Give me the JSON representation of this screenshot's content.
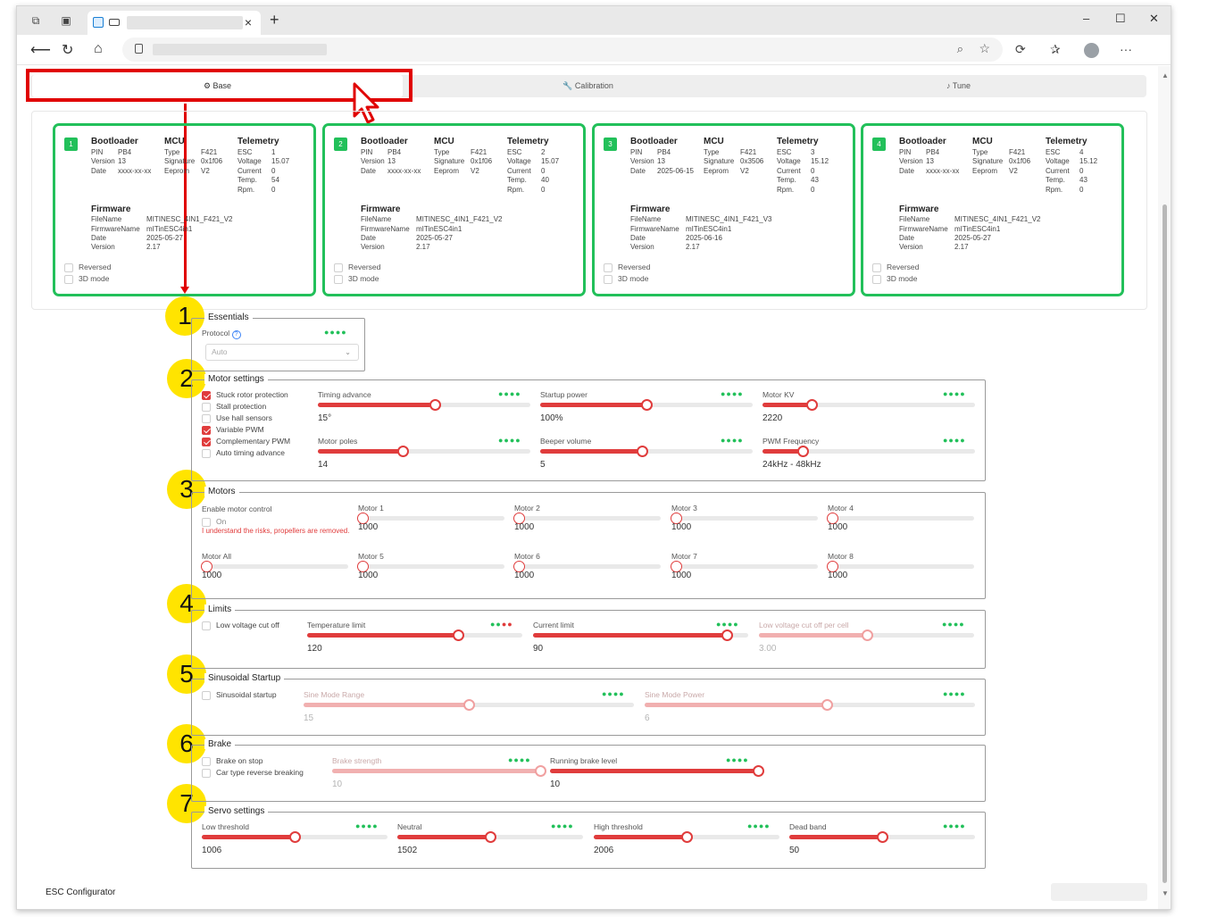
{
  "browser": {
    "tab_close": "×",
    "new_tab": "+",
    "more": "···",
    "controls": {
      "minimize": "–",
      "maximize": "☐",
      "close": "✕"
    }
  },
  "app": {
    "tabs": [
      {
        "label": "Base",
        "icon": "gear-icon",
        "active": true
      },
      {
        "label": "Calibration",
        "icon": "wrench-icon",
        "active": false
      },
      {
        "label": "Tune",
        "icon": "music-note-icon",
        "active": false
      }
    ],
    "footer": "ESC Configurator"
  },
  "escs": [
    {
      "id": "1",
      "bootloader": {
        "title": "Bootloader",
        "pin": "PB4",
        "version": "13",
        "date": "xxxx-xx-xx"
      },
      "mcu": {
        "title": "MCU",
        "type": "F421",
        "signature": "0x1f06",
        "eeprom": "V2"
      },
      "telemetry": {
        "title": "Telemetry",
        "esc": "1",
        "voltage": "15.07",
        "current": "0",
        "temp": "54",
        "rpm": "0"
      },
      "firmware": {
        "title": "Firmware",
        "filename": "MITINESC_4IN1_F421_V2",
        "firmwarename": "mITinESC4in1",
        "date": "2025-05-27",
        "version": "2.17"
      },
      "reversed": "Reversed",
      "mode3d": "3D mode"
    },
    {
      "id": "2",
      "bootloader": {
        "title": "Bootloader",
        "pin": "PB4",
        "version": "13",
        "date": "xxxx-xx-xx"
      },
      "mcu": {
        "title": "MCU",
        "type": "F421",
        "signature": "0x1f06",
        "eeprom": "V2"
      },
      "telemetry": {
        "title": "Telemetry",
        "esc": "2",
        "voltage": "15.07",
        "current": "0",
        "temp": "40",
        "rpm": "0"
      },
      "firmware": {
        "title": "Firmware",
        "filename": "MITINESC_4IN1_F421_V2",
        "firmwarename": "mITinESC4in1",
        "date": "2025-05-27",
        "version": "2.17"
      },
      "reversed": "Reversed",
      "mode3d": "3D mode"
    },
    {
      "id": "3",
      "bootloader": {
        "title": "Bootloader",
        "pin": "PB4",
        "version": "13",
        "date": "2025-06-15"
      },
      "mcu": {
        "title": "MCU",
        "type": "F421",
        "signature": "0x3506",
        "eeprom": "V2"
      },
      "telemetry": {
        "title": "Telemetry",
        "esc": "3",
        "voltage": "15.12",
        "current": "0",
        "temp": "43",
        "rpm": "0"
      },
      "firmware": {
        "title": "Firmware",
        "filename": "MITINESC_4IN1_F421_V3",
        "firmwarename": "mITinESC4in1",
        "date": "2025-06-16",
        "version": "2.17"
      },
      "reversed": "Reversed",
      "mode3d": "3D mode"
    },
    {
      "id": "4",
      "bootloader": {
        "title": "Bootloader",
        "pin": "PB4",
        "version": "13",
        "date": "xxxx-xx-xx"
      },
      "mcu": {
        "title": "MCU",
        "type": "F421",
        "signature": "0x1f06",
        "eeprom": "V2"
      },
      "telemetry": {
        "title": "Telemetry",
        "esc": "4",
        "voltage": "15.12",
        "current": "0",
        "temp": "43",
        "rpm": "0"
      },
      "firmware": {
        "title": "Firmware",
        "filename": "MITINESC_4IN1_F421_V2",
        "firmwarename": "mITinESC4in1",
        "date": "2025-05-27",
        "version": "2.17"
      },
      "reversed": "Reversed",
      "mode3d": "3D mode"
    }
  ],
  "labels": {
    "pin": "PIN",
    "version": "Version",
    "date": "Date",
    "type": "Type",
    "signature": "Signature",
    "eeprom": "Eeprom",
    "esc": "ESC",
    "voltage": "Voltage",
    "current": "Current",
    "temp": "Temp.",
    "rpm": "Rpm.",
    "filename": "FileName",
    "firmwarename": "FirmwareName"
  },
  "callouts": [
    "1",
    "2",
    "3",
    "4",
    "5",
    "6",
    "7"
  ],
  "essentials": {
    "legend": "Essentials",
    "protocol_label": "Protocol",
    "protocol_value": "Auto",
    "help": "?",
    "dots": "●●●●"
  },
  "motor_settings": {
    "legend": "Motor settings",
    "checkboxes": [
      {
        "label": "Stuck rotor protection",
        "checked": true
      },
      {
        "label": "Stall protection",
        "checked": false
      },
      {
        "label": "Use hall sensors",
        "checked": false
      },
      {
        "label": "Variable PWM",
        "checked": true
      },
      {
        "label": "Complementary PWM",
        "checked": true
      },
      {
        "label": "Auto timing advance",
        "checked": false
      }
    ],
    "sliders": [
      {
        "label": "Timing advance",
        "value": "15°",
        "level": 0.55
      },
      {
        "label": "Startup power",
        "value": "100%",
        "level": 0.5
      },
      {
        "label": "Motor KV",
        "value": "2220",
        "level": 0.23
      },
      {
        "label": "Motor poles",
        "value": "14",
        "level": 0.4
      },
      {
        "label": "Beeper volume",
        "value": "5",
        "level": 0.48
      },
      {
        "label": "PWM Frequency",
        "value": "24kHz - 48kHz",
        "level": 0.19
      }
    ]
  },
  "motors": {
    "legend": "Motors",
    "enable_label": "Enable motor control",
    "on_label": "On",
    "warning": "I understand the risks, propellers are removed.",
    "items": [
      {
        "label": "Motor 1",
        "value": "1000"
      },
      {
        "label": "Motor 2",
        "value": "1000"
      },
      {
        "label": "Motor 3",
        "value": "1000"
      },
      {
        "label": "Motor 4",
        "value": "1000"
      },
      {
        "label": "Motor All",
        "value": "1000"
      },
      {
        "label": "Motor 5",
        "value": "1000"
      },
      {
        "label": "Motor 6",
        "value": "1000"
      },
      {
        "label": "Motor 7",
        "value": "1000"
      },
      {
        "label": "Motor 8",
        "value": "1000"
      }
    ]
  },
  "limits": {
    "legend": "Limits",
    "checkbox": "Low voltage cut off",
    "sliders": [
      {
        "label": "Temperature limit",
        "value": "120",
        "level": 0.7
      },
      {
        "label": "Current limit",
        "value": "90",
        "level": 0.9
      },
      {
        "label": "Low voltage cut off per cell",
        "value": "3.00",
        "level": 0.5
      }
    ]
  },
  "sinusoidal": {
    "legend": "Sinusoidal Startup",
    "checkbox": "Sinusoidal startup",
    "sliders": [
      {
        "label": "Sine Mode Range",
        "value": "15",
        "level": 0.5
      },
      {
        "label": "Sine Mode Power",
        "value": "6",
        "level": 0.55
      }
    ]
  },
  "brake": {
    "legend": "Brake",
    "checkboxes": [
      "Brake on stop",
      "Car type reverse breaking"
    ],
    "sliders": [
      {
        "label": "Brake strength",
        "value": "10",
        "level": 1.0
      },
      {
        "label": "Running brake level",
        "value": "10",
        "level": 1.0
      }
    ]
  },
  "servo": {
    "legend": "Servo settings",
    "sliders": [
      {
        "label": "Low threshold",
        "value": "1006",
        "level": 0.5
      },
      {
        "label": "Neutral",
        "value": "1502",
        "level": 0.5
      },
      {
        "label": "High threshold",
        "value": "2006",
        "level": 0.5
      },
      {
        "label": "Dead band",
        "value": "50",
        "level": 0.5
      }
    ]
  }
}
